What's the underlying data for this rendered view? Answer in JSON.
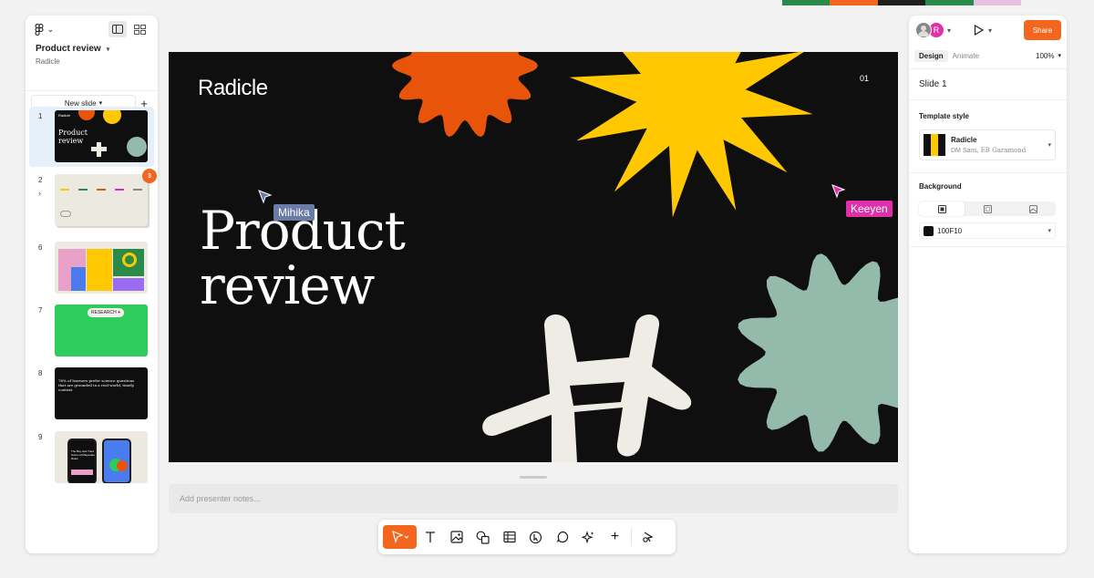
{
  "app": {
    "file_title": "Product review",
    "team": "Radicle",
    "new_slide_label": "New slide",
    "add_icon": "plus-icon"
  },
  "slides": [
    {
      "number": "1",
      "title_line1": "Product",
      "title_line2": "review",
      "brand": "Radicle"
    },
    {
      "number": "2",
      "comment_count": "3"
    },
    {
      "number": "6"
    },
    {
      "number": "7",
      "label": "RESEARCH"
    },
    {
      "number": "8",
      "text": "76% of learners prefer science questions that are grounded in a real-world, timely context."
    },
    {
      "number": "9",
      "text": "The Boy Has Tried Some Lift Bayesian Rules"
    }
  ],
  "canvas": {
    "brand": "Radicle",
    "slide_number": "01",
    "title_line1": "Product",
    "title_line2": "review",
    "background": "#100F10",
    "shape_colors": {
      "orange": "#E8540A",
      "yellow": "#FFC800",
      "sage": "#93BAAA",
      "cream": "#EFECE6"
    }
  },
  "cursors": [
    {
      "name": "Mihika",
      "color": "#6A7BA8"
    },
    {
      "name": "Keeyen",
      "color": "#E02FA8"
    }
  ],
  "notes_placeholder": "Add presenter notes...",
  "toolbar": {
    "tools": [
      "cursor-icon",
      "text-icon",
      "image-icon",
      "shapes-icon",
      "table-icon",
      "interaction-icon",
      "comment-icon",
      "ai-icon",
      "plus-icon",
      "plugin-icon"
    ]
  },
  "right_panel": {
    "share_label": "Share",
    "avatar_initial": "R",
    "tabs": [
      "Design",
      "Animate"
    ],
    "zoom": "100%",
    "slide_label": "Slide 1",
    "template_style_heading": "Template style",
    "template_name": "Radicle",
    "template_font_1": "DM Sans,",
    "template_font_2": "EB Garamond",
    "background_heading": "Background",
    "background_hex": "100F10"
  },
  "colors": {
    "accent": "#F2661F",
    "selection": "#E5F0FB"
  }
}
